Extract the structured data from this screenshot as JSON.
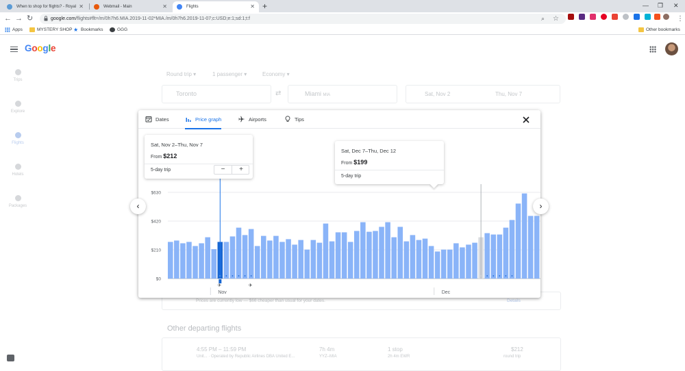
{
  "browser": {
    "tabs": [
      {
        "title": "When to shop for flights? - Royal",
        "active": false,
        "favicon_color": "#5b9bd5"
      },
      {
        "title": "Webmail - Main",
        "active": false,
        "favicon_color": "#e8590c"
      },
      {
        "title": "Flights",
        "active": true,
        "favicon_color": "#4285f4"
      }
    ],
    "url_host": "google.com",
    "url_path": "/flights#flt=/m/0h7h6.MIA.2019-11-02*MIA./m/0h7h6.2019-11-07;c:USD;e:1;sd:1;t:f",
    "bookmarks": [
      "Apps",
      "MYSTERY SHOP",
      "Bookmarks",
      "GGG"
    ],
    "other_bookmarks": "Other bookmarks"
  },
  "header": {
    "logo_letters": [
      "G",
      "o",
      "o",
      "g",
      "l",
      "e"
    ]
  },
  "leftnav": [
    {
      "label": "Trips",
      "active": false
    },
    {
      "label": "Explore",
      "active": false
    },
    {
      "label": "Flights",
      "active": true
    },
    {
      "label": "Hotels",
      "active": false
    },
    {
      "label": "Packages",
      "active": false
    }
  ],
  "search": {
    "trip_type": "Round trip",
    "passengers": "1 passenger",
    "cabin": "Economy",
    "origin": "Toronto",
    "destination": "Miami",
    "destination_code": "MIA",
    "depart": "Sat, Nov 2",
    "return": "Thu, Nov 7"
  },
  "background_rows": {
    "notice": "Prices are currently low — $66 cheaper than usual for your dates.",
    "details": "Details",
    "section_title": "Other departing flights",
    "flight": {
      "times": "4:55 PM – 11:59 PM",
      "airline": "Unit...",
      "operator": "Operated by Republic Airlines DBA United E...",
      "duration": "7h 4m",
      "route": "YYZ–MIA",
      "stops": "1 stop",
      "layover": "2h 4m EWR",
      "price": "$212",
      "price_note": "round trip"
    }
  },
  "modal": {
    "tabs": [
      {
        "label": "Dates",
        "icon": "calendar-icon",
        "active": false
      },
      {
        "label": "Price graph",
        "icon": "bar-chart-icon",
        "active": true
      },
      {
        "label": "Airports",
        "icon": "airplane-icon",
        "active": false
      },
      {
        "label": "Tips",
        "icon": "lightbulb-icon",
        "active": false
      }
    ],
    "selected_tip": {
      "dates": "Sat, Nov 2–Thu, Nov 7",
      "from_label": "From",
      "price": "$212",
      "trip_length": "5-day trip",
      "minus": "−",
      "plus": "+"
    },
    "hover_tip": {
      "dates": "Sat, Dec 7–Thu, Dec 12",
      "from_label": "From",
      "price": "$199",
      "trip_length": "5-day trip"
    },
    "prev_icon": "chevron-left-icon",
    "next_icon": "chevron-right-icon"
  },
  "chart_data": {
    "type": "bar",
    "ylim": [
      0,
      630
    ],
    "y_ticks": [
      0,
      210,
      420,
      630
    ],
    "y_tick_labels": [
      "$0",
      "$210",
      "$420",
      "$630"
    ],
    "x_labels": [
      {
        "label": "Nov",
        "index": 8
      },
      {
        "label": "Dec",
        "index": 44
      }
    ],
    "grid": true,
    "colors": {
      "bar": "#8ab4f8",
      "selected": "#1967d2",
      "hover": "#dadce0",
      "line": "#1a73e8"
    },
    "selected_index": 8,
    "hover_index": 50,
    "values": [
      268,
      278,
      258,
      268,
      238,
      258,
      302,
      215,
      268,
      268,
      308,
      372,
      318,
      362,
      238,
      312,
      278,
      312,
      268,
      288,
      248,
      282,
      212,
      282,
      262,
      402,
      272,
      338,
      338,
      268,
      348,
      412,
      342,
      348,
      378,
      412,
      302,
      378,
      272,
      318,
      282,
      292,
      238,
      198,
      212,
      212,
      258,
      228,
      248,
      262,
      302,
      332,
      322,
      322,
      372,
      428,
      548,
      622,
      458,
      458
    ]
  }
}
